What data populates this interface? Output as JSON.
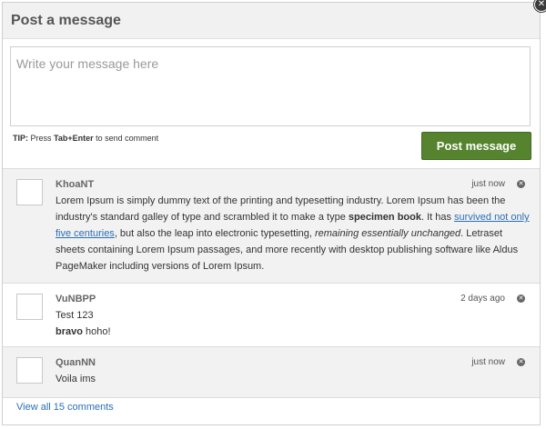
{
  "dialog": {
    "title": "Post a message",
    "close_icon": "close-icon"
  },
  "composer": {
    "placeholder": "Write your message here",
    "tip_prefix": "TIP:",
    "tip_text": " Press ",
    "tip_keys": "Tab+Enter",
    "tip_suffix": " to send comment",
    "post_label": "Post message"
  },
  "comments": [
    {
      "author": "KhoaNT",
      "time": "just now",
      "text_1": "Lorem Ipsum is simply dummy text of the printing and typesetting industry. Lorem Ipsum has been the industry's standard galley of type and scrambled it to make a type ",
      "bold": "specimen book",
      "text_2": ". It has ",
      "link": "survived not only five centuries",
      "text_3": ", but also the leap into electronic typesetting, ",
      "italic": "remaining essentially unchanged",
      "text_4": ". Letraset sheets containing Lorem Ipsum passages, and more recently with desktop publishing software like Aldus PageMaker including versions of Lorem Ipsum."
    },
    {
      "author": "VuNBPP",
      "time": "2 days ago",
      "line1": "Test 123",
      "bold": "bravo",
      "rest": " hoho!"
    },
    {
      "author": "QuanNN",
      "time": "just now",
      "line1": "Voila ims"
    }
  ],
  "footer": {
    "view_all": "View all 15 comments"
  }
}
